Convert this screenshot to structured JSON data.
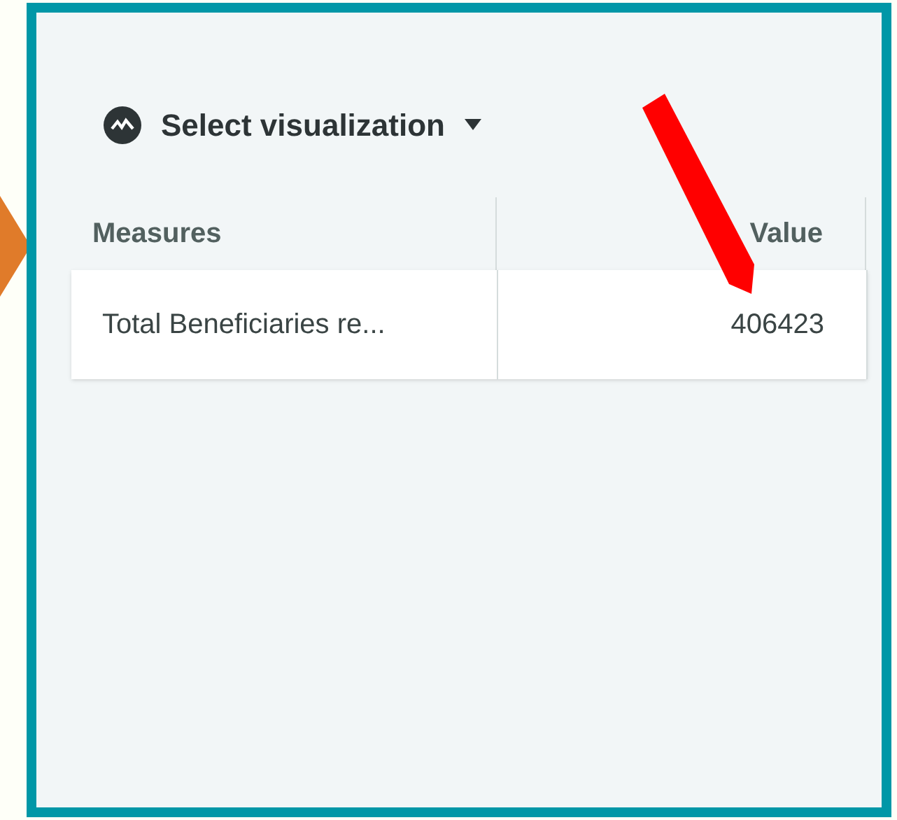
{
  "toolbar": {
    "label": "Select visualization"
  },
  "table": {
    "columns": [
      "Measures",
      "Value"
    ],
    "rows": [
      {
        "cells": [
          "Total Beneficiaries re...",
          "406423"
        ]
      }
    ]
  }
}
